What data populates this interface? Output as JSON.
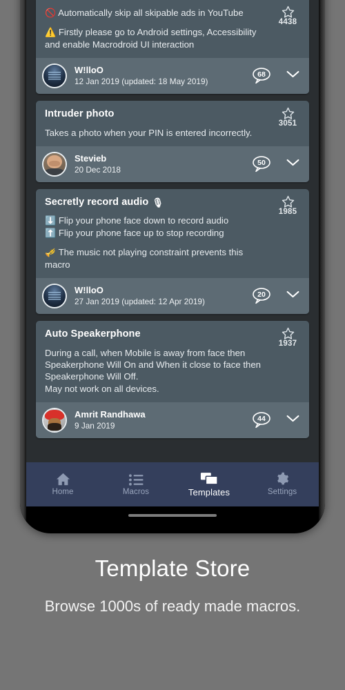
{
  "caption": {
    "title": "Template Store",
    "subtitle": "Browse 1000s of ready made macros."
  },
  "app": {
    "accent_navy": "#343f5c",
    "card_bg": "#4c5a63",
    "card_footer_bg": "#5d6b74",
    "page_bg": "#757575"
  },
  "templates": [
    {
      "id": "youtube-ad-skipper",
      "title": "",
      "desc_lines": [
        {
          "emoji": "🚫",
          "text": "Automatically skip all skipable ads in YouTube",
          "spaced": false
        },
        {
          "emoji": "⚠️",
          "text": "Firstly please go to Android settings, Accessibility and enable Macrodroid UI interaction",
          "spaced": true
        }
      ],
      "fav_count": "4438",
      "author": "W!lloO",
      "date": "12 Jan 2019 (updated: 18 May 2019)",
      "comments": "68",
      "avatar_style": "dark-album"
    },
    {
      "id": "intruder-photo",
      "title": "Intruder photo",
      "desc_lines": [
        {
          "emoji": "",
          "text": "Takes a photo when your PIN is entered incorrectly.",
          "spaced": false
        }
      ],
      "fav_count": "3051",
      "author": "Stevieb",
      "date": "20 Dec 2018",
      "comments": "50",
      "avatar_style": "man-bald"
    },
    {
      "id": "secretly-record-audio",
      "title": "Secretly record audio",
      "title_emoji": "🎙",
      "desc_lines": [
        {
          "emoji": "⬇️",
          "text": "Flip your phone face down to record audio",
          "spaced": false
        },
        {
          "emoji": "⬆️",
          "text": "Flip your phone face up to stop recording",
          "spaced": false
        },
        {
          "emoji": "🎺",
          "text": "The music not playing constraint prevents this macro",
          "spaced": true
        }
      ],
      "fav_count": "1985",
      "author": "W!lloO",
      "date": "27 Jan 2019 (updated: 12 Apr 2019)",
      "comments": "20",
      "avatar_style": "dark-album"
    },
    {
      "id": "auto-speakerphone",
      "title": "Auto Speakerphone",
      "desc_lines": [
        {
          "emoji": "",
          "text": "During a call, when Mobile is away from face then Speakerphone Will On and When it close to face then Speakerphone Will Off.",
          "spaced": false
        },
        {
          "emoji": "",
          "text": "May not work on all devices.",
          "spaced": false
        }
      ],
      "fav_count": "1937",
      "author": "Amrit Randhawa",
      "date": "9 Jan 2019",
      "comments": "44",
      "avatar_style": "man-turban"
    }
  ],
  "bottom_nav": {
    "items": [
      {
        "label": "Home",
        "icon": "home-icon",
        "active": false
      },
      {
        "label": "Macros",
        "icon": "list-icon",
        "active": false
      },
      {
        "label": "Templates",
        "icon": "templates-icon",
        "active": true
      },
      {
        "label": "Settings",
        "icon": "gear-icon",
        "active": false
      }
    ]
  }
}
